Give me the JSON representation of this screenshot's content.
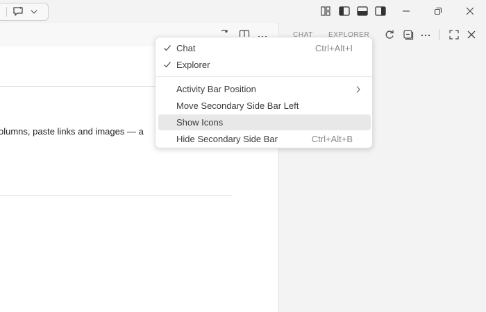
{
  "menu": {
    "items": [
      {
        "label": "Chat",
        "shortcut": "Ctrl+Alt+I",
        "checked": true
      },
      {
        "label": "Explorer",
        "shortcut": "",
        "checked": true
      },
      {
        "label": "Activity Bar Position",
        "shortcut": "",
        "submenu": true
      },
      {
        "label": "Move Secondary Side Bar Left",
        "shortcut": ""
      },
      {
        "label": "Show Icons",
        "shortcut": "",
        "highlighted": true
      },
      {
        "label": "Hide Secondary Side Bar",
        "shortcut": "Ctrl+Alt+B"
      }
    ]
  },
  "editor": {
    "body_text": "olumns, paste links and images — a"
  },
  "secondary": {
    "tabs": [
      "CHAT",
      "EXPLORER"
    ]
  },
  "colors": {
    "titlebar_bg": "#f3f3f3",
    "sidebar_bg": "#f3f3f3",
    "menu_highlight": "#e8e8e8",
    "shortcut_text": "#8a8a8a"
  },
  "icons": {
    "titlebar": [
      "chat-icon",
      "chevron-down-icon",
      "customize-layout-icon",
      "toggle-primary-sidebar-icon",
      "toggle-panel-icon",
      "toggle-secondary-sidebar-icon",
      "minimize-icon",
      "restore-icon",
      "close-icon"
    ],
    "editor_actions": [
      "open-changes-icon",
      "split-editor-icon",
      "more-actions-icon"
    ],
    "secondary_actions": [
      "refresh-icon",
      "collapse-all-icon",
      "more-actions-icon",
      "maximize-icon",
      "close-icon"
    ]
  }
}
